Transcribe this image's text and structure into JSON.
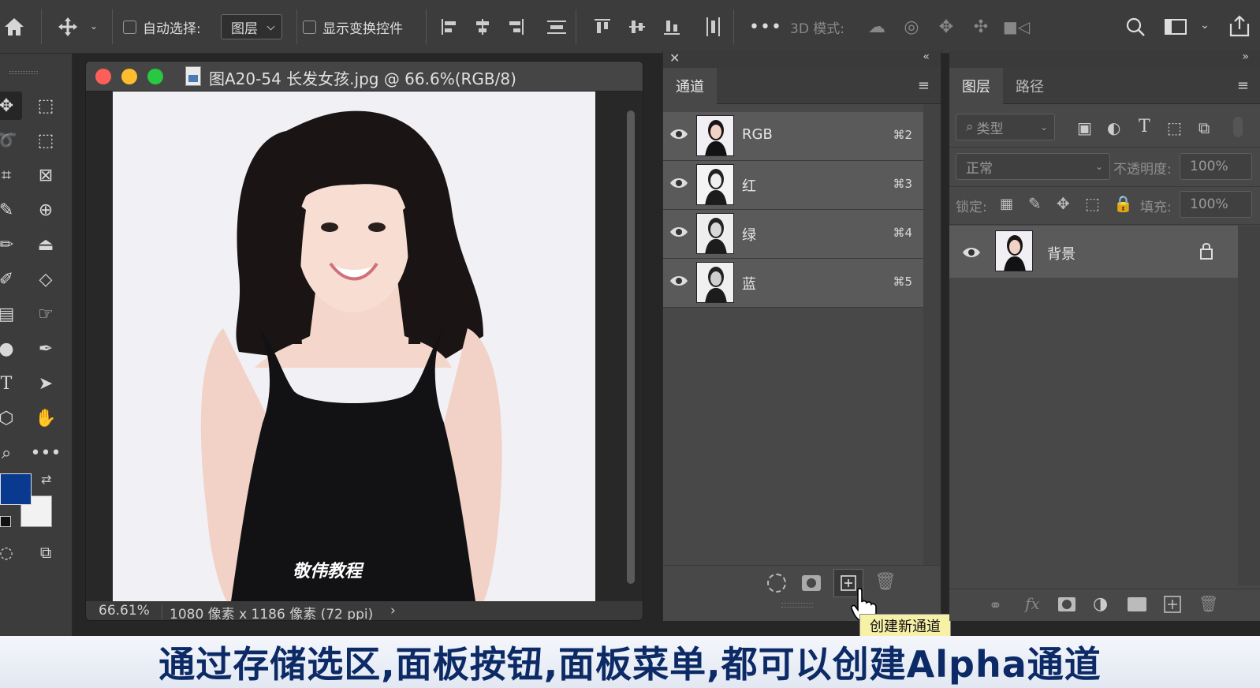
{
  "options_bar": {
    "auto_select_label": "自动选择:",
    "auto_select_value": "图层",
    "show_transform_label": "显示变换控件",
    "mode_3d_label": "3D 模式:",
    "more_label": "•••"
  },
  "document": {
    "title": "图A20-54 长发女孩.jpg @ 66.6%(RGB/8)",
    "zoom": "66.61%",
    "dimensions": "1080 像素 x 1186 像素 (72 ppi)",
    "watermark": "敬伟教程"
  },
  "channels_panel": {
    "tab_label": "通道",
    "channels": [
      {
        "name": "RGB",
        "shortcut": "⌘2"
      },
      {
        "name": "红",
        "shortcut": "⌘3"
      },
      {
        "name": "绿",
        "shortcut": "⌘4"
      },
      {
        "name": "蓝",
        "shortcut": "⌘5"
      }
    ],
    "tooltip": "创建新通道"
  },
  "layers_panel": {
    "tab_layers": "图层",
    "tab_paths": "路径",
    "filter_placeholder": "类型",
    "blend_mode": "正常",
    "opacity_label": "不透明度:",
    "opacity_value": "100%",
    "lock_label": "锁定:",
    "fill_label": "填充:",
    "fill_value": "100%",
    "layers": [
      {
        "name": "背景"
      }
    ]
  },
  "caption": "通过存储选区,面板按钮,面板菜单,都可以创建Alpha通道",
  "colors": {
    "foreground": "#0a3a8f",
    "background": "#f2f2f2",
    "caption_text": "#0c2a66",
    "close_light": "#fe5f57",
    "min_light": "#febc2e",
    "max_light": "#28c840"
  }
}
